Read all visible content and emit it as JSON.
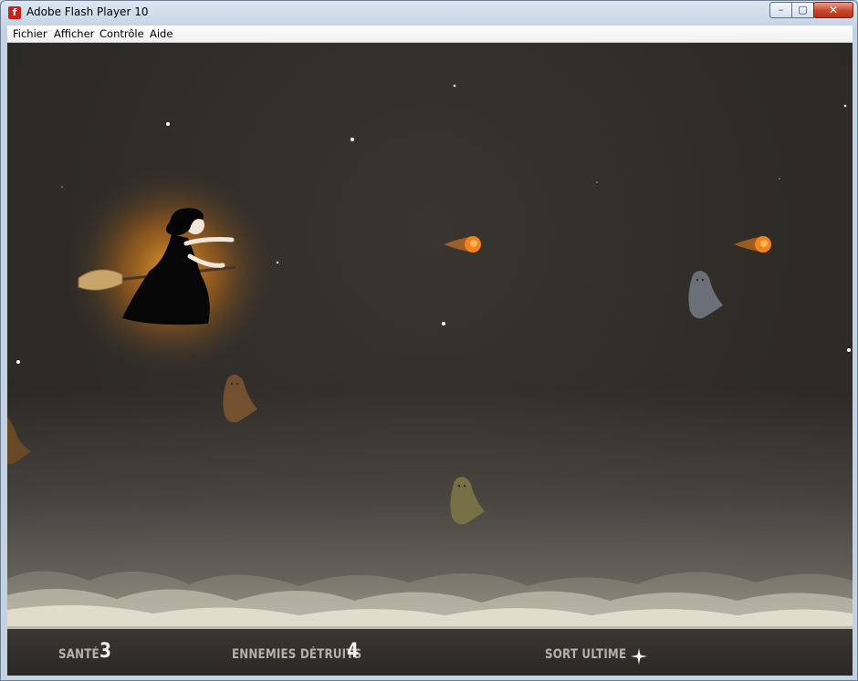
{
  "window": {
    "title": "Adobe Flash Player 10",
    "icon": "flash-player-icon",
    "controls": {
      "minimize": "–",
      "maximize": "▢",
      "close": "✕"
    }
  },
  "menu": [
    {
      "label": "Fichier"
    },
    {
      "label": "Afficher"
    },
    {
      "label": "Contrôle"
    },
    {
      "label": "Aide"
    }
  ],
  "game": {
    "sky_color": "#2f2c28",
    "glow_color": "#e08a1a",
    "fireball_color": "#f5821f",
    "hud": {
      "health_label": "SANTÉ",
      "health_value": "3",
      "enemies_label": "ENNEMIES DÉTRUITS",
      "enemies_value": "4",
      "ultimate_label": "SORT ULTIME",
      "ultimate_icon": "sparkle-star-icon"
    }
  }
}
